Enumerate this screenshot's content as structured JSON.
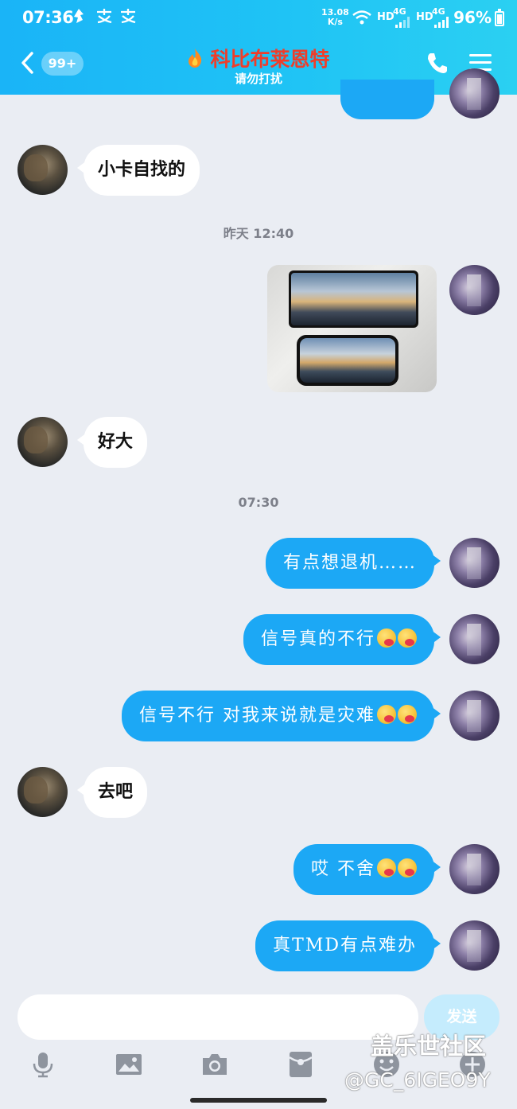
{
  "status_bar": {
    "time": "07:36",
    "notif_icons": [
      "钉钉",
      "支",
      "支"
    ],
    "net_speed_value": "13.08",
    "net_speed_unit": "K/s",
    "hd_label": "HD",
    "signal_label": "4G",
    "battery": "96%"
  },
  "header": {
    "unread_count": "99+",
    "contact_name": "科比布莱恩特",
    "contact_status": "请勿打扰"
  },
  "messages": {
    "m1": "小卡自找的",
    "ts1": "昨天 12:40",
    "m3": "好大",
    "ts2": "07:30",
    "m4": "有点想退机……",
    "m5": "信号真的不行",
    "m6": "信号不行 对我来说就是灾难",
    "m7": "去吧",
    "m8": "哎 不舍",
    "m9": "真TMD有点难办"
  },
  "composer": {
    "input_value": "",
    "send_label": "发送"
  },
  "watermark": {
    "main": "盖乐世社区",
    "sub": "@GC_6IGEO9Y"
  },
  "colors": {
    "header_gradient_start": "#1ab4f7",
    "bubble_me": "#1ca8f5",
    "contact_name": "#ef3d2a",
    "background": "#eaedf3"
  },
  "icons": [
    "back-chevron-icon",
    "fire-icon",
    "phone-call-icon",
    "menu-icon",
    "voice-icon",
    "image-icon",
    "camera-icon",
    "red-packet-icon",
    "emoji-icon",
    "plus-icon"
  ]
}
